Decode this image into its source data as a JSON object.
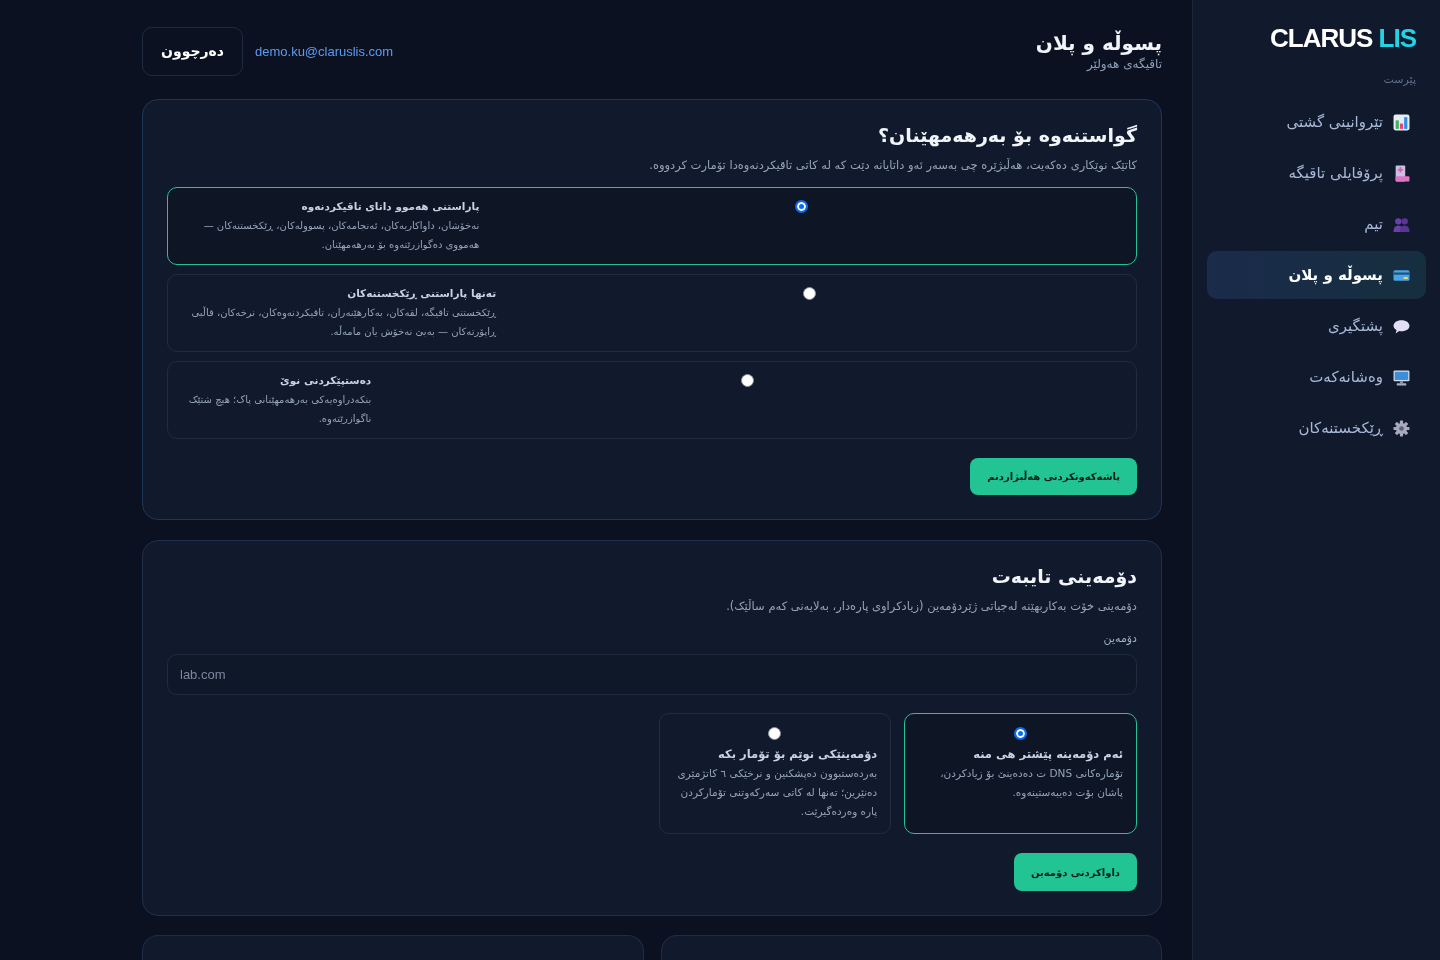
{
  "sidebar": {
    "logo": {
      "name": "CLARUS",
      "suffix": "LIS"
    },
    "section_label": "پێرست",
    "items": [
      {
        "label": "تێروانینی گشتی",
        "selected": false
      },
      {
        "label": "پرۆفایلی تاقیگە",
        "selected": false
      },
      {
        "label": "تیم",
        "selected": false
      },
      {
        "label": "پسوڵە و پلان",
        "selected": true
      },
      {
        "label": "پشتگیری",
        "selected": false
      },
      {
        "label": "وەشانەکەت",
        "selected": false
      },
      {
        "label": "ڕێکخستنەکان",
        "selected": false
      }
    ]
  },
  "header": {
    "title": "پسوڵە و پلان",
    "subtitle": "تاقیگەی هەولێر",
    "email": "demo.ku@claruslis.com",
    "logout_button": "دەرچوون"
  },
  "production_card": {
    "title": "گواستنەوە بۆ بەرهەمهێنان؟",
    "description": "کاتێک نوێکاری دەکەیت، هەڵبژێرە چی بەسەر ئەو داتایانە دێت کە لە کاتی تاقیکردنەوەدا تۆمارت کردووە.",
    "options": [
      {
        "title": "پاراستنی هەموو داتای تاقیکردنەوە",
        "description": "نەخۆشان، داواکاریەکان، ئەنجامەکان، پسوولەکان، ڕێکخستنەکان — هەمووی دەگوازرێتەوە بۆ بەرهەمهێنان.",
        "selected": true
      },
      {
        "title": "تەنها پاراستنی ڕێکخستنەکان",
        "description": "ڕێکخستنی تاقیگە، لقەکان، بەکارهێنەران، تاقیکردنەوەکان، نرخەکان، قاڵبی ڕاپۆرتەکان — بەبێ نەخۆش یان مامەڵە.",
        "selected": false
      },
      {
        "title": "دەستپێکردنی نوێ",
        "description": "بنکەدراوەیەکی بەرهەمهێنانی پاک؛ هیچ شتێک ناگوازرێتەوە.",
        "selected": false
      }
    ],
    "save_button": "پاشەکەوتکردنی هەڵبژاردنم"
  },
  "domain_card": {
    "title": "دۆمەینی تایبەت",
    "description": "دۆمەینی خۆت بەکاربهێنە لەجیاتی ژێردۆمەین (زیادکراوی پارەدار، بەلایەنی کەم ساڵێک).",
    "field": {
      "label": "دۆمەین",
      "placeholder": "lab.com"
    },
    "options": [
      {
        "title": "ئەم دۆمەینە پێشتر هی منە",
        "description": "تۆمارەکانی DNS ت دەدەینێ بۆ زیادکردن، پاشان بۆت دەیبەستینەوە.",
        "selected": true
      },
      {
        "title": "دۆمەینێکی نوێم بۆ تۆمار بکە",
        "description": "بەردەستبوون دەپشکنین و نرخێکی ٦ کاتژمێری دەنێرین؛ تەنها لە کاتی سەرکەوتنی تۆمارکردن پارە وەردەگیرێت.",
        "selected": false
      }
    ],
    "submit_button": "داواکردنی دۆمەین"
  }
}
